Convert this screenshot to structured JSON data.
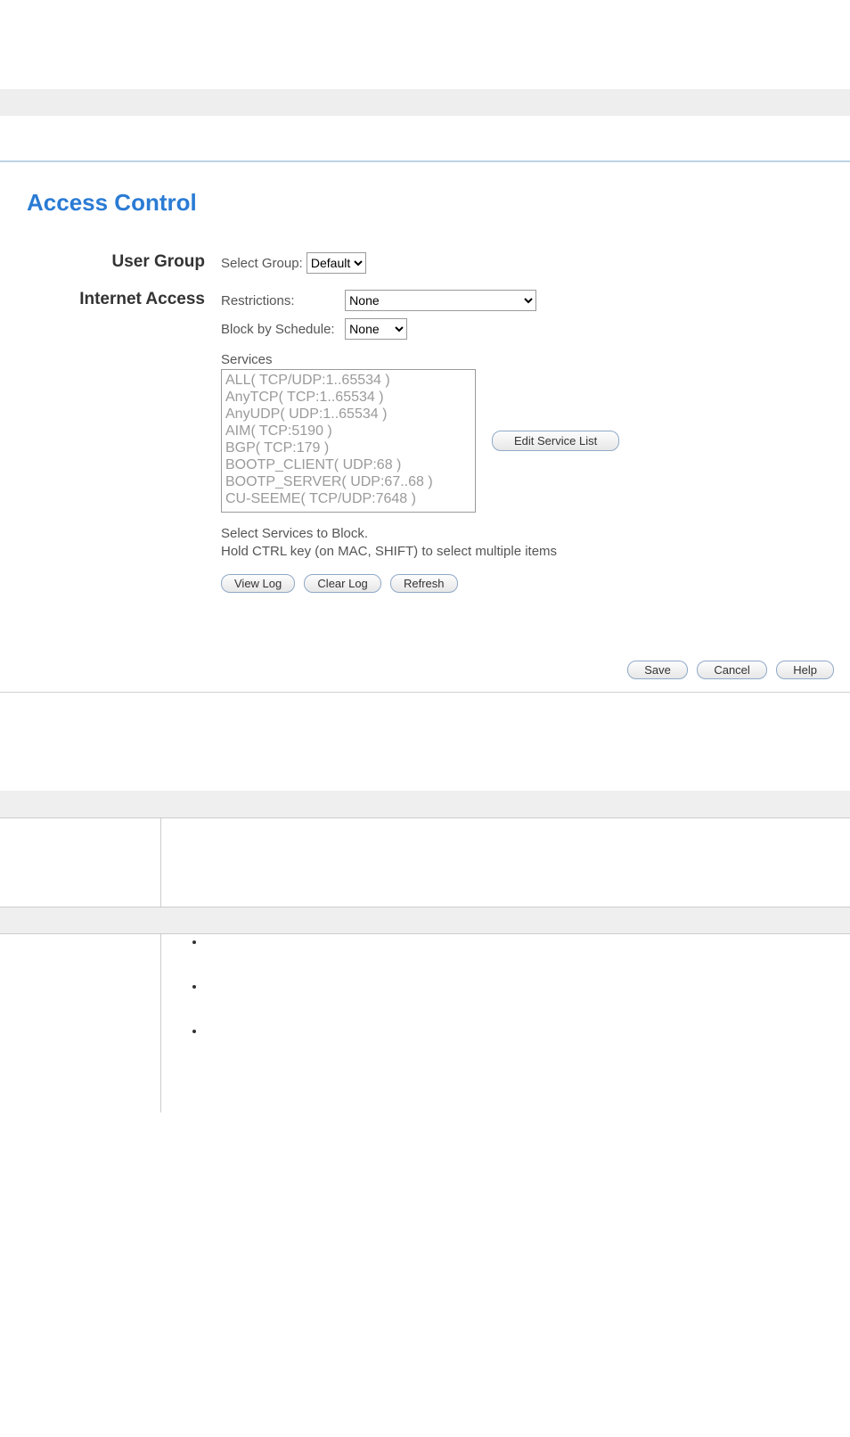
{
  "title": "Access Control",
  "userGroup": {
    "label": "User Group",
    "selectLabel": "Select Group:",
    "value": "Default"
  },
  "internetAccess": {
    "label": "Internet Access",
    "restrictionsLabel": "Restrictions:",
    "restrictionsValue": "None",
    "scheduleLabel": "Block by Schedule:",
    "scheduleValue": "None",
    "servicesLabel": "Services",
    "services": [
      "ALL( TCP/UDP:1..65534 )",
      "AnyTCP( TCP:1..65534 )",
      "AnyUDP( UDP:1..65534 )",
      "AIM( TCP:5190 )",
      "BGP( TCP:179 )",
      "BOOTP_CLIENT( UDP:68 )",
      "BOOTP_SERVER( UDP:67..68 )",
      "CU-SEEME( TCP/UDP:7648 )"
    ],
    "editServiceBtn": "Edit Service List",
    "hint1": "Select Services to Block.",
    "hint2": "Hold CTRL key (on MAC, SHIFT) to select multiple items"
  },
  "buttons": {
    "viewLog": "View Log",
    "clearLog": "Clear Log",
    "refresh": "Refresh",
    "save": "Save",
    "cancel": "Cancel",
    "help": "Help"
  }
}
